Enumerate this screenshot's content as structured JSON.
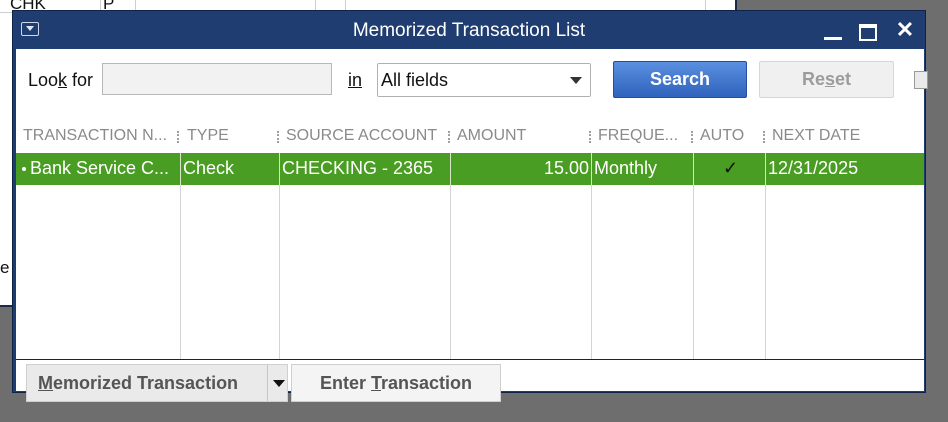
{
  "background": {
    "text_1": "CHK",
    "text_2": "P",
    "text_3": "e"
  },
  "window": {
    "title": "Memorized Transaction List"
  },
  "search": {
    "lookfor_label": "Look for",
    "lookfor_value": "",
    "in_label": "in",
    "field_selected": "All fields",
    "search_label": "Search",
    "reset_label": "Reset"
  },
  "table": {
    "headers": [
      "TRANSACTION N...",
      "TYPE",
      "SOURCE ACCOUNT",
      "AMOUNT",
      "FREQUE...",
      "AUTO",
      "NEXT DATE"
    ],
    "rows": [
      {
        "name": "Bank Service C...",
        "type": "Check",
        "source_account": "CHECKING - 2365",
        "amount": "15.00",
        "frequency": "Monthly",
        "auto": "✓",
        "next_date": "12/31/2025"
      }
    ],
    "selected_row_color": "#4a9d23"
  },
  "buttons": {
    "memorized_transaction": "Memorized Transaction",
    "enter_transaction": "Enter Transaction"
  },
  "colors": {
    "titlebar": "#1f3d70",
    "search_button": "#2f63bd"
  }
}
